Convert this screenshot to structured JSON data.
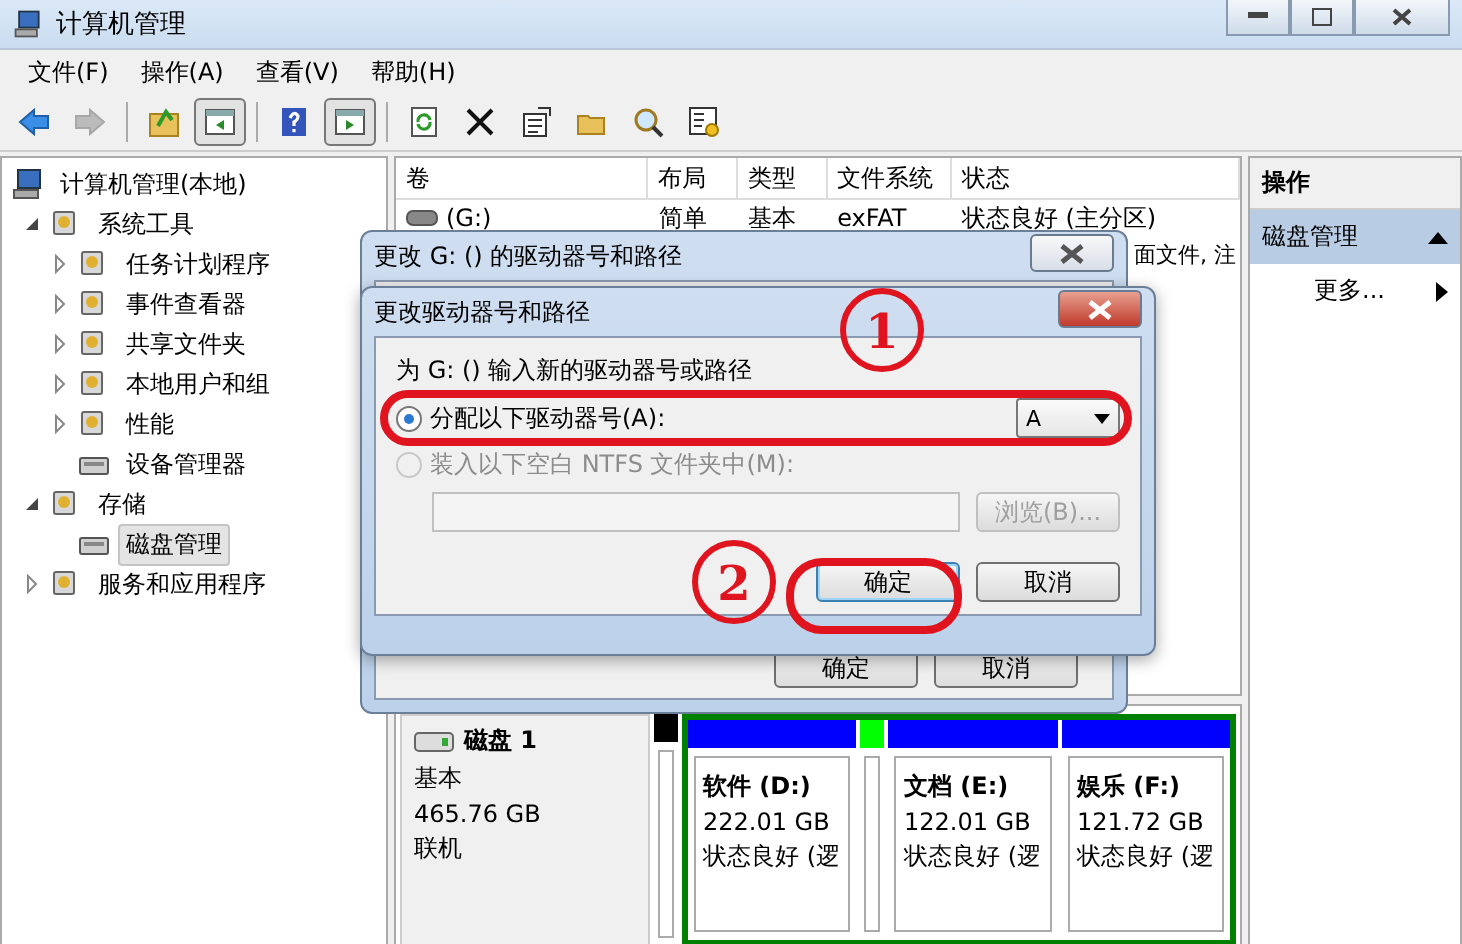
{
  "window": {
    "title": "计算机管理"
  },
  "menu": [
    "文件(F)",
    "操作(A)",
    "查看(V)",
    "帮助(H)"
  ],
  "toolbar": [
    {
      "disabled": false,
      "pressed": false
    },
    {
      "disabled": true,
      "pressed": false
    },
    {
      "disabled": false,
      "pressed": false
    },
    {
      "disabled": false,
      "pressed": true
    },
    {
      "disabled": false,
      "pressed": false
    },
    {
      "disabled": false,
      "pressed": true
    },
    {
      "disabled": false,
      "pressed": false
    },
    {
      "disabled": false,
      "pressed": false
    },
    {
      "disabled": false,
      "pressed": false
    },
    {
      "disabled": false,
      "pressed": false
    },
    {
      "disabled": false,
      "pressed": false
    },
    {
      "disabled": false,
      "pressed": false
    }
  ],
  "tree": [
    {
      "label": "计算机管理(本地)",
      "kind": "root",
      "selected": false,
      "children": [
        {
          "label": "系统工具",
          "kind": "node",
          "expanded": true,
          "selected": false,
          "children": [
            {
              "label": "任务计划程序",
              "kind": "node",
              "expanded": false,
              "selected": false
            },
            {
              "label": "事件查看器",
              "kind": "node",
              "expanded": false,
              "selected": false
            },
            {
              "label": "共享文件夹",
              "kind": "node",
              "expanded": false,
              "selected": false
            },
            {
              "label": "本地用户和组",
              "kind": "node",
              "expanded": false,
              "selected": false
            },
            {
              "label": "性能",
              "kind": "node",
              "expanded": false,
              "selected": false
            },
            {
              "label": "设备管理器",
              "kind": "leaf",
              "selected": false
            }
          ]
        },
        {
          "label": "存储",
          "kind": "node",
          "expanded": true,
          "selected": false,
          "children": [
            {
              "label": "磁盘管理",
              "kind": "leaf",
              "selected": true
            }
          ]
        },
        {
          "label": "服务和应用程序",
          "kind": "node",
          "expanded": false,
          "selected": false
        }
      ]
    }
  ],
  "volumes": {
    "columns": [
      "卷",
      "布局",
      "类型",
      "文件系统",
      "状态"
    ],
    "rows": [
      {
        "kind": "full",
        "cells": [
          "(G:)",
          "简单",
          "基本",
          "exFAT",
          "状态良好 (主分区)"
        ]
      },
      {
        "kind": "covered",
        "visible_text": "面文件, 注"
      }
    ]
  },
  "disk": {
    "name": "磁盘 1",
    "type": "基本",
    "size": "465.76 GB",
    "status": "联机",
    "unallocated": {
      "color": "#000000"
    },
    "extended": {
      "color": "#008000",
      "partitions": [
        {
          "kind": "volume",
          "color": "#0000ff",
          "name": "软件 (D:)",
          "size": "222.01 GB",
          "status": "状态良好 (逻"
        },
        {
          "kind": "free",
          "color": "#00ff00"
        },
        {
          "kind": "volume",
          "color": "#0000ff",
          "name": "文档 (E:)",
          "size": "122.01 GB",
          "status": "状态良好 (逻"
        },
        {
          "kind": "volume",
          "color": "#0000ff",
          "name": "娱乐 (F:)",
          "size": "121.72 GB",
          "status": "状态良好 (逻"
        }
      ]
    }
  },
  "actions": {
    "title": "操作",
    "section": "磁盘管理",
    "items": [
      "更多..."
    ]
  },
  "dialog_back": {
    "title": "更改 G: () 的驱动器号和路径",
    "buttons": [
      "确定",
      "取消"
    ]
  },
  "dialog": {
    "title": "更改驱动器号和路径",
    "prompt": "为 G: () 输入新的驱动器号或路径",
    "options": [
      {
        "label": "分配以下驱动器号(A):",
        "selected": true,
        "disabled": false
      },
      {
        "label": "装入以下空白 NTFS 文件夹中(M):",
        "selected": false,
        "disabled": true
      }
    ],
    "drive_letter": "A",
    "browse": {
      "label": "浏览(B)...",
      "disabled": true
    },
    "buttons": [
      {
        "label": "确定",
        "focused": true
      },
      {
        "label": "取消",
        "focused": false
      }
    ]
  },
  "annotations": [
    {
      "label": "1"
    },
    {
      "label": "2"
    }
  ]
}
